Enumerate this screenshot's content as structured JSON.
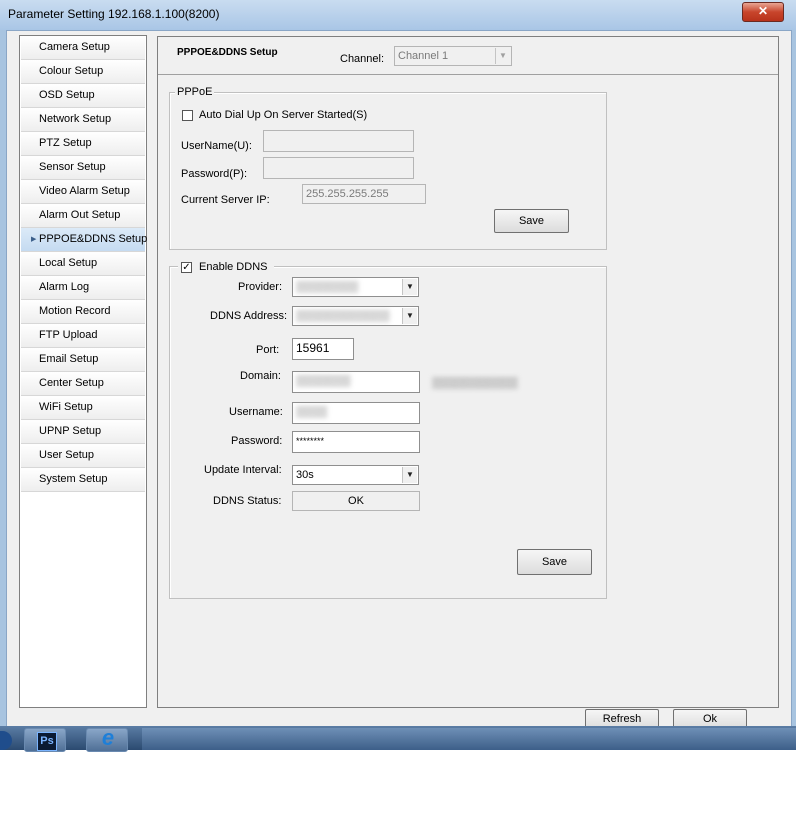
{
  "window": {
    "title": "Parameter Setting 192.168.1.100(8200)",
    "close_glyph": "✕"
  },
  "sidebar": {
    "items": [
      {
        "label": "Camera Setup"
      },
      {
        "label": "Colour Setup"
      },
      {
        "label": "OSD Setup"
      },
      {
        "label": "Network Setup"
      },
      {
        "label": "PTZ Setup"
      },
      {
        "label": "Sensor Setup"
      },
      {
        "label": "Video Alarm Setup"
      },
      {
        "label": "Alarm Out Setup"
      },
      {
        "label": "PPPOE&DDNS Setup",
        "selected": true
      },
      {
        "label": "Local Setup"
      },
      {
        "label": "Alarm Log"
      },
      {
        "label": "Motion Record"
      },
      {
        "label": "FTP Upload"
      },
      {
        "label": "Email Setup"
      },
      {
        "label": "Center Setup"
      },
      {
        "label": "WiFi Setup"
      },
      {
        "label": "UPNP Setup"
      },
      {
        "label": "User Setup"
      },
      {
        "label": "System Setup"
      }
    ]
  },
  "header": {
    "title": "PPPOE&DDNS Setup",
    "channel_label": "Channel:",
    "channel_value": "Channel 1"
  },
  "pppoe": {
    "group_title": "PPPoE",
    "auto_dial_label": "Auto Dial Up On Server Started(S)",
    "auto_dial_checked": false,
    "username_label": "UserName(U):",
    "username_value": "",
    "password_label": "Password(P):",
    "password_value": "",
    "server_ip_label": "Current Server IP:",
    "server_ip_value": "255.255.255.255",
    "save_label": "Save"
  },
  "ddns": {
    "enable_label": "Enable DDNS",
    "enable_checked": true,
    "provider_label": "Provider:",
    "provider_value": "▒▒▒▒▒▒▒▒",
    "address_label": "DDNS Address:",
    "address_value": "▒▒▒▒▒▒▒▒▒▒▒▒",
    "port_label": "Port:",
    "port_value": "15961",
    "domain_label": "Domain:",
    "domain_value": "▒▒▒▒▒▒▒",
    "domain_suffix": "▒▒▒▒▒▒▒▒▒▒▒",
    "username_label": "Username:",
    "username_value": "▒▒▒▒",
    "password_label": "Password:",
    "password_value": "********",
    "interval_label": "Update Interval:",
    "interval_value": "30s",
    "status_label": "DDNS Status:",
    "status_value": "OK",
    "save_label": "Save"
  },
  "footer": {
    "refresh_label": "Refresh",
    "ok_label": "Ok"
  },
  "taskbar": {
    "ps_label": "Ps",
    "ie_label": "e"
  }
}
